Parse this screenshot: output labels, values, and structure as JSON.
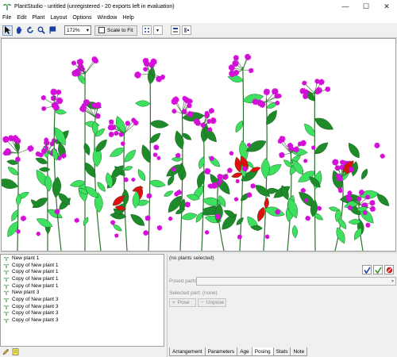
{
  "window": {
    "title": "PlantStudio - untitled (unregistered - 20 exports left in evaluation)",
    "min_glyph": "—",
    "max_glyph": "☐",
    "close_glyph": "✕"
  },
  "menu": [
    "File",
    "Edit",
    "Plant",
    "Layout",
    "Options",
    "Window",
    "Help"
  ],
  "toolbar": {
    "zoom_value": "172%",
    "scale_label": "Scale to Fit"
  },
  "plants": [
    {
      "label": "New plant 1",
      "selected": false
    },
    {
      "label": "Copy of New plant 1",
      "selected": false
    },
    {
      "label": "Copy of New plant 1",
      "selected": false
    },
    {
      "label": "Copy of New plant 1",
      "selected": false
    },
    {
      "label": "Copy of New plant 1",
      "selected": false
    },
    {
      "label": "New plant 3",
      "selected": false
    },
    {
      "label": "Copy of New plant 3",
      "selected": false
    },
    {
      "label": "Copy of New plant 3",
      "selected": false
    },
    {
      "label": "Copy of New plant 3",
      "selected": false
    },
    {
      "label": "Copy of New plant 3",
      "selected": false
    }
  ],
  "panel": {
    "status": "(no plants selected)",
    "posed_parts_label": "Posed parts",
    "selected_part_label": "Selected part: (none)",
    "pose_button": "Pose",
    "unpose_button": "Unpose"
  },
  "tabs": [
    "Arrangement",
    "Parameters",
    "Age",
    "Posing",
    "Stats",
    "Note"
  ],
  "colors": {
    "flower": "#d40fd8",
    "leaf_light": "#3ee060",
    "leaf_dark": "#1f8a2a",
    "red_leaf": "#e01010",
    "stem": "#2d6f2d"
  }
}
